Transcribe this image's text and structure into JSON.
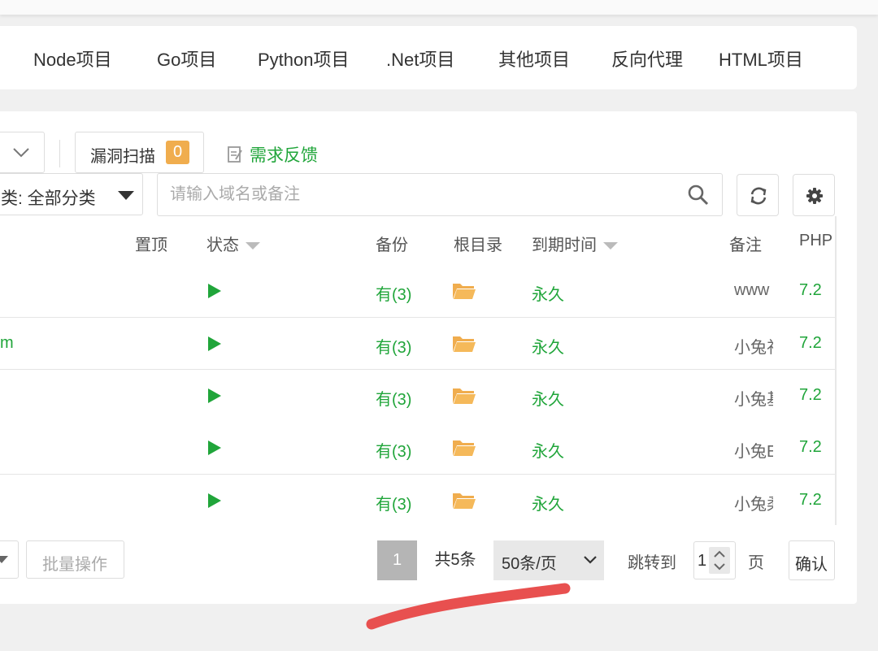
{
  "project_tabs": [
    "Node项目",
    "Go项目",
    "Python项目",
    ".Net项目",
    "其他项目",
    "反向代理",
    "HTML项目"
  ],
  "toolbar": {
    "vuln_scan_label": "漏洞扫描",
    "vuln_scan_count": "0",
    "feedback_label": "需求反馈"
  },
  "filters": {
    "category_label": "类: 全部分类",
    "search_placeholder": "请输入域名或备注"
  },
  "table": {
    "headers": {
      "pin": "置顶",
      "status": "状态",
      "backup": "备份",
      "root_dir": "根目录",
      "expiry": "到期时间",
      "remark": "备注",
      "php": "PHP"
    },
    "rows": [
      {
        "name": "",
        "backup": "有(3)",
        "expiry": "永久",
        "remark": "www",
        "php": "7.2"
      },
      {
        "name": "m",
        "backup": "有(3)",
        "expiry": "永久",
        "remark": "小兔礼",
        "php": "7.2"
      },
      {
        "name": "",
        "backup": "有(3)",
        "expiry": "永久",
        "remark": "小兔基",
        "php": "7.2"
      },
      {
        "name": "",
        "backup": "有(3)",
        "expiry": "永久",
        "remark": "小兔E",
        "php": "7.2"
      },
      {
        "name": "",
        "backup": "有(3)",
        "expiry": "永久",
        "remark": "小兔柔",
        "php": "7.2"
      }
    ]
  },
  "footer": {
    "batch_label": "批量操作",
    "current_page": "1",
    "total_label": "共5条",
    "page_size_label": "50条/页",
    "jump_label": "跳转到",
    "jump_value": "1",
    "page_unit": "页",
    "confirm_label": "确认"
  },
  "colors": {
    "accent_green": "#20a53a",
    "badge_orange": "#f0ad4e",
    "folder_orange": "#f0ad4e",
    "annotation_red": "#e8504f"
  }
}
